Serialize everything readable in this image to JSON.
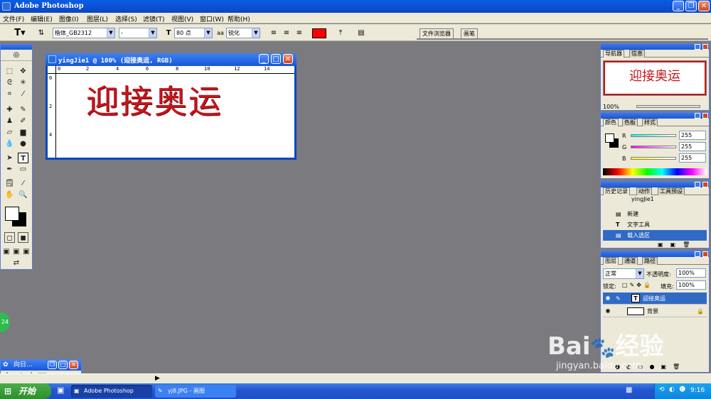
{
  "app": {
    "title": "Adobe Photoshop"
  },
  "menu": [
    "文件(F)",
    "编辑(E)",
    "图像(I)",
    "图层(L)",
    "选择(S)",
    "滤镜(T)",
    "视图(V)",
    "窗口(W)",
    "帮助(H)"
  ],
  "options": {
    "tool_glyph": "T",
    "font_family": "楷体_GB2312",
    "font_style": "-",
    "font_size": "80 点",
    "aa_label": "aa",
    "antialias": "锐化",
    "color_swatch": "#ff0000"
  },
  "top_tabs": [
    "文件浏览器",
    "画笔"
  ],
  "document": {
    "title": "yingJie1 @ 100% (迎接奥运, RGB)",
    "text": "迎接奥运",
    "ruler_h": [
      "0",
      "2",
      "4",
      "6",
      "8",
      "10",
      "12",
      "14"
    ],
    "ruler_v": [
      "0",
      "2",
      "4"
    ]
  },
  "navigator": {
    "tabs": [
      "导航器",
      "信息"
    ],
    "zoom": "100%",
    "thumb_text": "迎接奥运"
  },
  "color": {
    "tabs": [
      "颜色",
      "色板",
      "样式"
    ],
    "channels": [
      {
        "label": "R",
        "value": "255"
      },
      {
        "label": "G",
        "value": "255"
      },
      {
        "label": "B",
        "value": "255"
      }
    ]
  },
  "history": {
    "tabs": [
      "历史记录",
      "动作",
      "工具预设"
    ],
    "snapshot": "yingJie1",
    "items": [
      "新建",
      "文字工具",
      "载入选区"
    ]
  },
  "layers": {
    "tabs": [
      "图层",
      "通道",
      "路径"
    ],
    "blend": "正常",
    "opacity_label": "不透明度:",
    "opacity": "100%",
    "lock_label": "锁定:",
    "fill_label": "填充:",
    "fill": "100%",
    "items": [
      {
        "name": "迎接奥运",
        "type": "T"
      },
      {
        "name": "背景",
        "type": "bg"
      }
    ]
  },
  "ime": {
    "title": "向日...",
    "row": "中 ♪ °, 大 ⌨ 📷"
  },
  "side_badge": "24",
  "taskbar": {
    "start": "开始",
    "tasks": [
      "Adobe Photoshop",
      "yj8.JPG - 画图"
    ],
    "clock": "9:16"
  },
  "watermark": {
    "brand": "Bai",
    "brand2": "经验",
    "url": "jingyan.baidu.com"
  }
}
